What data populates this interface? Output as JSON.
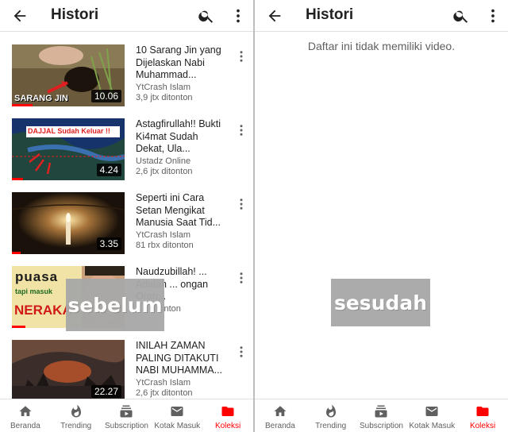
{
  "left_panel": {
    "title": "Histori",
    "videos": [
      {
        "title": "10 Sarang Jin yang Dijelaskan Nabi Muhammad...",
        "channel": "YtCrash Islam",
        "views": "3,9 jtx ditonton",
        "duration": "10.06",
        "thumb_text": "SARANG JIN",
        "watched_fraction": 0.18
      },
      {
        "title": "Astagfirullah!! Bukti Ki4mat Sudah Dekat, Ula...",
        "channel": "Ustadz Online",
        "views": "2,6 jtx ditonton",
        "duration": "4.24",
        "thumb_text": "DAJJAL Sudah Keluar !!",
        "watched_fraction": 0.1
      },
      {
        "title": "Seperti ini Cara Setan Mengikat Manusia Saat Tid...",
        "channel": "YtCrash Islam",
        "views": "81 rbx ditonton",
        "duration": "3.35",
        "thumb_text": "",
        "watched_fraction": 0.08
      },
      {
        "title": "Naudzubillah! ... Adalah ... ongan Oran...",
        "channel": "",
        "views": "...x ditonton",
        "duration": "",
        "thumb_text_1": "puasa",
        "thumb_text_2": "tapi masuk",
        "thumb_text_3": "NERAKA",
        "watched_fraction": 0.12
      },
      {
        "title": "INILAH ZAMAN PALING DITAKUTI NABI MUHAMMA...",
        "channel": "YtCrash Islam",
        "views": "2,6 jtx ditonton",
        "duration": "22.27",
        "thumb_text": "",
        "watched_fraction": 0.0
      }
    ],
    "stamp": "sebelum"
  },
  "right_panel": {
    "title": "Histori",
    "empty_message": "Daftar ini tidak memiliki video.",
    "stamp": "sesudah"
  },
  "tabs": [
    {
      "label": "Beranda",
      "icon": "home-icon"
    },
    {
      "label": "Trending",
      "icon": "fire-icon"
    },
    {
      "label": "Subscription",
      "icon": "subscriptions-icon"
    },
    {
      "label": "Kotak Masuk",
      "icon": "inbox-icon"
    },
    {
      "label": "Koleksi",
      "icon": "folder-icon",
      "active": true
    }
  ],
  "colors": {
    "accent": "#ff0000",
    "text": "#212121",
    "secondary": "#616161",
    "stamp": "#a8a8a8"
  }
}
